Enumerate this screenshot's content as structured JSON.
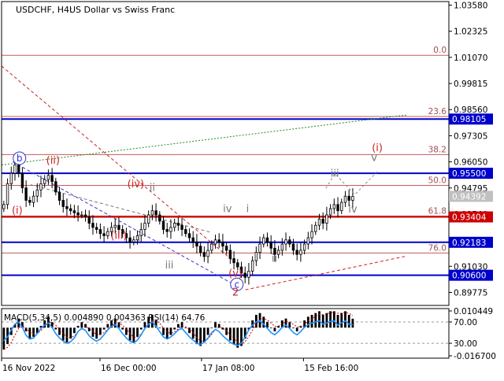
{
  "header": {
    "symbol_label": "USDCHF, H4:",
    "description": "US Dollar vs Swiss Franc"
  },
  "colors": {
    "background": "#ffffff",
    "frame": "#000000",
    "candle": "#000000",
    "key_level": "#0000cc",
    "fib": "#b22222",
    "fib_label": "#a05050",
    "support": "#cc0000",
    "wave_red": "#cc2222",
    "wave_gray": "#777777",
    "trend_green": "#228b22",
    "trend_red": "#cc2222",
    "trend_blue": "#3333cc",
    "macd_hist": "#000000",
    "macd_signal": "#cc0000",
    "rsi": "#1e90ff",
    "label_box_bg": "#0000cc",
    "label_box_fg": "#ffffff",
    "current_price_bg": "#c0c0c0"
  },
  "chart_data": [
    {
      "type": "candlestick",
      "title": "USDCHF, H4: US Dollar vs Swiss Franc",
      "ylim": [
        0.8915,
        1.0375
      ],
      "y_ticks": [
        "1.03580",
        "1.02325",
        "1.01070",
        "0.99815",
        "0.98560",
        "0.97305",
        "0.96050",
        "0.94795",
        "0.93540",
        "0.92285",
        "0.91030",
        "0.89775"
      ],
      "x_ticks": [
        "16 Nov 2022",
        "16 Dec 00:00",
        "17 Jan 08:00",
        "15 Feb 16:00"
      ],
      "grid": false,
      "approximate_closes": [
        0.94,
        0.95,
        0.955,
        0.959,
        0.955,
        0.948,
        0.942,
        0.941,
        0.944,
        0.947,
        0.95,
        0.952,
        0.954,
        0.951,
        0.946,
        0.942,
        0.939,
        0.938,
        0.937,
        0.936,
        0.935,
        0.935,
        0.934,
        0.931,
        0.929,
        0.928,
        0.926,
        0.925,
        0.927,
        0.929,
        0.93,
        0.928,
        0.926,
        0.924,
        0.922,
        0.923,
        0.925,
        0.928,
        0.931,
        0.935,
        0.937,
        0.935,
        0.932,
        0.928,
        0.927,
        0.929,
        0.931,
        0.93,
        0.928,
        0.926,
        0.924,
        0.922,
        0.92,
        0.917,
        0.915,
        0.918,
        0.921,
        0.923,
        0.922,
        0.92,
        0.918,
        0.914,
        0.912,
        0.91,
        0.907,
        0.905,
        0.908,
        0.913,
        0.917,
        0.921,
        0.924,
        0.922,
        0.919,
        0.916,
        0.918,
        0.921,
        0.923,
        0.921,
        0.918,
        0.916,
        0.918,
        0.921,
        0.924,
        0.927,
        0.93,
        0.933,
        0.931,
        0.935,
        0.938,
        0.94,
        0.937,
        0.941,
        0.944,
        0.942,
        0.9439
      ],
      "horizontal_levels": [
        {
          "value": 0.98105,
          "label": "0.98105",
          "style": "key"
        },
        {
          "value": 0.955,
          "label": "0.95500",
          "style": "key"
        },
        {
          "value": 0.93404,
          "label": "0.93404",
          "style": "support"
        },
        {
          "value": 0.92183,
          "label": "0.92183",
          "style": "key"
        },
        {
          "value": 0.906,
          "label": "0.90600",
          "style": "key"
        }
      ],
      "current_price": {
        "value": 0.94392,
        "label": "0.94392"
      },
      "fib_levels": [
        {
          "label": "0.0",
          "value": 1.0117
        },
        {
          "label": "23.6",
          "value": 0.9823
        },
        {
          "label": "38.2",
          "value": 0.964
        },
        {
          "label": "50.0",
          "value": 0.9492
        },
        {
          "label": "61.8",
          "value": 0.9345
        },
        {
          "label": "76.0",
          "value": 0.9167
        }
      ],
      "wave_labels": [
        {
          "text": "b",
          "circled": true,
          "color": "blue",
          "at": [
            0.04,
            0.9607
          ]
        },
        {
          "text": "(ii)",
          "color": "red",
          "at": [
            0.115,
            0.9595
          ]
        },
        {
          "text": "(i)",
          "color": "red",
          "at": [
            0.035,
            0.9355
          ]
        },
        {
          "text": "(iv)",
          "color": "red",
          "at": [
            0.3,
            0.9482
          ]
        },
        {
          "text": "ii",
          "color": "gray",
          "at": [
            0.337,
            0.9465
          ]
        },
        {
          "text": "(iii)",
          "color": "red",
          "at": [
            0.262,
            0.9235
          ]
        },
        {
          "text": "i",
          "color": "gray",
          "at": [
            0.307,
            0.922
          ]
        },
        {
          "text": "iii",
          "color": "gray",
          "at": [
            0.375,
            0.9093
          ]
        },
        {
          "text": "iv",
          "color": "gray",
          "at": [
            0.505,
            0.9363
          ]
        },
        {
          "text": "i",
          "color": "gray",
          "at": [
            0.55,
            0.9363
          ]
        },
        {
          "text": "ii",
          "color": "gray",
          "at": [
            0.61,
            0.9125
          ]
        },
        {
          "text": "(v)",
          "color": "red",
          "at": [
            0.523,
            0.9053
          ]
        },
        {
          "text": "c",
          "circled": true,
          "color": "blue",
          "at": [
            0.526,
            0.9001
          ]
        },
        {
          "text": "2",
          "color": "red",
          "at": [
            0.523,
            0.8962
          ]
        },
        {
          "text": "iii",
          "color": "gray",
          "at": [
            0.745,
            0.9533
          ]
        },
        {
          "text": "iv",
          "color": "gray",
          "at": [
            0.785,
            0.9362
          ]
        },
        {
          "text": "v",
          "color": "gray",
          "at": [
            0.833,
            0.9609
          ]
        },
        {
          "text": "(i)",
          "color": "red",
          "at": [
            0.84,
            0.9657
          ]
        }
      ],
      "forecast_path": [
        [
          0.725,
          0.9478
        ],
        [
          0.745,
          0.9548
        ],
        [
          0.79,
          0.9448
        ],
        [
          0.84,
          0.9558
        ]
      ],
      "trendlines": [
        {
          "color": "green",
          "style": "dotted",
          "points": [
            [
              0.0,
              0.959
            ],
            [
              0.905,
              0.983
            ]
          ]
        },
        {
          "color": "red",
          "style": "dashed",
          "points": [
            [
              0.0,
              1.0065
            ],
            [
              0.52,
              0.9125
            ]
          ]
        },
        {
          "color": "red",
          "style": "dashed",
          "points": [
            [
              0.545,
              0.899
            ],
            [
              0.905,
              0.9152
            ]
          ]
        },
        {
          "color": "blue",
          "style": "dashed",
          "points": [
            [
              0.025,
              0.9605
            ],
            [
              0.52,
              0.9015
            ]
          ]
        },
        {
          "color": "gray",
          "style": "dashed",
          "points": [
            [
              0.065,
              0.9495
            ],
            [
              0.47,
              0.9265
            ]
          ]
        }
      ]
    },
    {
      "type": "indicator",
      "title": "MACD(5,34,5) 0.004890 0.004363 RSI(14) 64.76",
      "indicators": [
        {
          "name": "MACD(5,34,5)",
          "values": [
            0.00489,
            0.004363
          ]
        },
        {
          "name": "RSI(14)",
          "value": 64.76
        }
      ],
      "ylim": [
        -0.0167,
        0.010449
      ],
      "y_ticks": [
        "0.010449",
        "70.00",
        "30.00",
        "-0.016700"
      ],
      "rsi_levels": [
        70,
        30
      ],
      "macd_histogram": [
        -0.012,
        -0.009,
        -0.004,
        0.002,
        0.005,
        0.003,
        -0.002,
        -0.006,
        -0.005,
        -0.003,
        0.001,
        0.004,
        0.006,
        0.003,
        -0.001,
        -0.004,
        -0.007,
        -0.008,
        -0.006,
        -0.003,
        0.001,
        0.003,
        0.002,
        -0.002,
        -0.005,
        -0.006,
        -0.004,
        -0.001,
        0.002,
        0.004,
        0.005,
        0.003,
        -0.001,
        -0.004,
        -0.007,
        -0.008,
        -0.005,
        -0.001,
        0.003,
        0.006,
        0.007,
        0.004,
        0.0,
        -0.004,
        -0.006,
        -0.004,
        -0.001,
        0.002,
        0.003,
        0.0,
        -0.003,
        -0.006,
        -0.009,
        -0.01,
        -0.008,
        -0.004,
        0.0,
        0.003,
        0.002,
        -0.001,
        -0.004,
        -0.007,
        -0.009,
        -0.011,
        -0.01,
        -0.006,
        -0.001,
        0.004,
        0.007,
        0.008,
        0.006,
        0.003,
        0.0,
        -0.002,
        0.001,
        0.004,
        0.005,
        0.003,
        0.0,
        -0.002,
        0.001,
        0.004,
        0.006,
        0.007,
        0.008,
        0.009,
        0.007,
        0.008,
        0.009,
        0.009,
        0.007,
        0.008,
        0.009,
        0.007,
        0.0049
      ],
      "rsi": [
        35,
        42,
        55,
        66,
        70,
        60,
        45,
        38,
        40,
        48,
        58,
        64,
        68,
        60,
        48,
        40,
        34,
        30,
        33,
        40,
        52,
        58,
        54,
        44,
        38,
        34,
        38,
        46,
        55,
        62,
        65,
        58,
        48,
        40,
        34,
        31,
        36,
        46,
        58,
        66,
        70,
        62,
        52,
        42,
        38,
        42,
        48,
        55,
        58,
        50,
        42,
        36,
        30,
        28,
        32,
        40,
        50,
        56,
        52,
        44,
        38,
        32,
        28,
        26,
        30,
        42,
        55,
        64,
        70,
        72,
        66,
        58,
        50,
        46,
        52,
        60,
        64,
        58,
        50,
        46,
        52,
        60,
        65,
        68,
        70,
        72,
        66,
        68,
        71,
        72,
        64,
        68,
        72,
        66,
        64.76
      ]
    }
  ]
}
